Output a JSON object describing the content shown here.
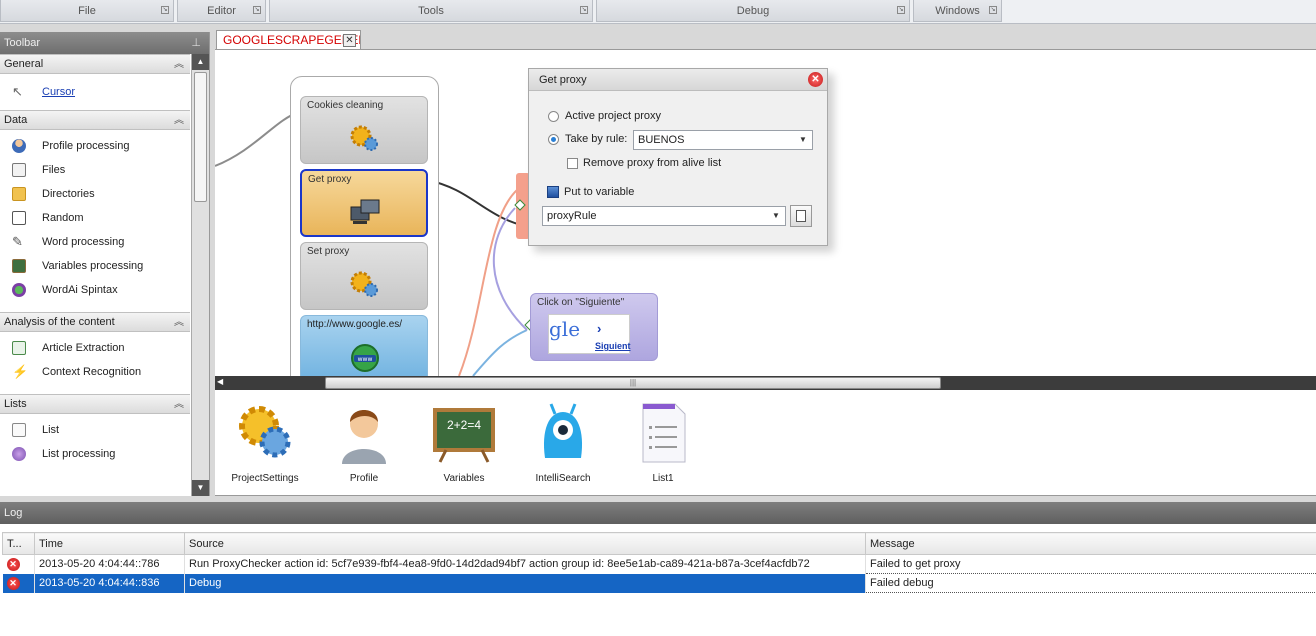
{
  "ribbon": {
    "groups": [
      "File",
      "Editor",
      "Tools",
      "Debug",
      "Windows"
    ]
  },
  "toolbar": {
    "title": "Toolbar",
    "sections": {
      "general": {
        "title": "General",
        "items": [
          "Cursor"
        ]
      },
      "data": {
        "title": "Data",
        "items": [
          "Profile processing",
          "Files",
          "Directories",
          "Random",
          "Word processing",
          "Variables processing",
          "WordAi Spintax"
        ]
      },
      "analysis": {
        "title": "Analysis of the content",
        "items": [
          "Article Extraction",
          "Context Recognition"
        ]
      },
      "lists": {
        "title": "Lists",
        "items": [
          "List",
          "List processing"
        ]
      }
    }
  },
  "doc_tab": {
    "label": "GOOGLESCRAPEGENERATOR"
  },
  "canvas": {
    "blocks": [
      "Cookies cleaning",
      "Get proxy",
      "Set proxy",
      "http://www.google.es/",
      "Click on \"Siguiente\""
    ],
    "click_preview": {
      "logo_text": "gle",
      "link": "Siguient"
    }
  },
  "dialog": {
    "title": "Get proxy",
    "option_active": "Active project proxy",
    "option_rule": "Take by rule:",
    "rule_value": "BUENOS",
    "remove_proxy": "Remove proxy from alive list",
    "put_to_variable": "Put to variable",
    "variable_value": "proxyRule"
  },
  "icons": [
    "ProjectSettings",
    "Profile",
    "Variables",
    "IntelliSearch",
    "List1"
  ],
  "variables_board": "2+2=4",
  "log": {
    "title": "Log",
    "columns": [
      "T...",
      "Time",
      "Source",
      "Message"
    ],
    "rows": [
      {
        "time": "2013-05-20   4:04:44::786",
        "source": "Run ProxyChecker action id: 5cf7e939-fbf4-4ea8-9fd0-14d2dad94bf7 action group id: 8ee5e1ab-ca89-421a-b87a-3cef4acfdb72",
        "message": "Failed to get proxy"
      },
      {
        "time": "2013-05-20   4:04:44::836",
        "source": "Debug",
        "message": "Failed debug"
      }
    ]
  }
}
